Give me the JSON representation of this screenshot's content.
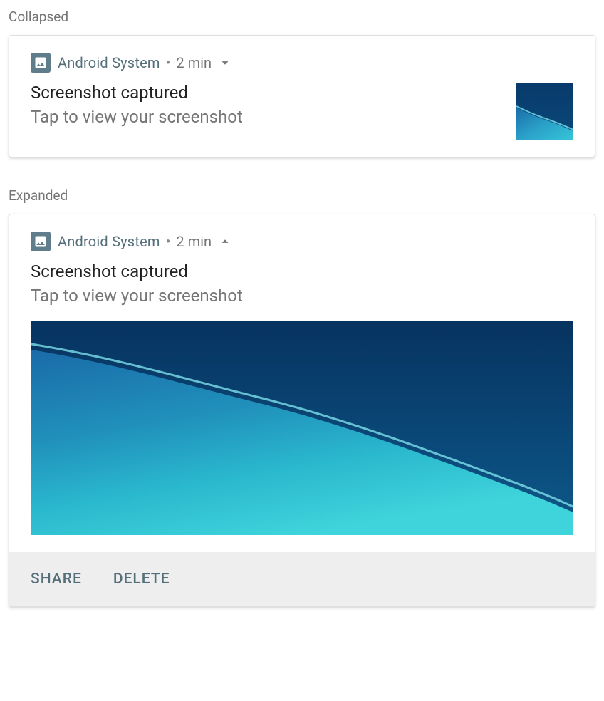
{
  "labels": {
    "collapsed": "Collapsed",
    "expanded": "Expanded"
  },
  "notification": {
    "app_name": "Android  System",
    "separator": "•",
    "timestamp": "2 min",
    "title": "Screenshot captured",
    "subtitle": "Tap to view your screenshot"
  },
  "actions": {
    "share": "SHARE",
    "delete": "DELETE"
  }
}
